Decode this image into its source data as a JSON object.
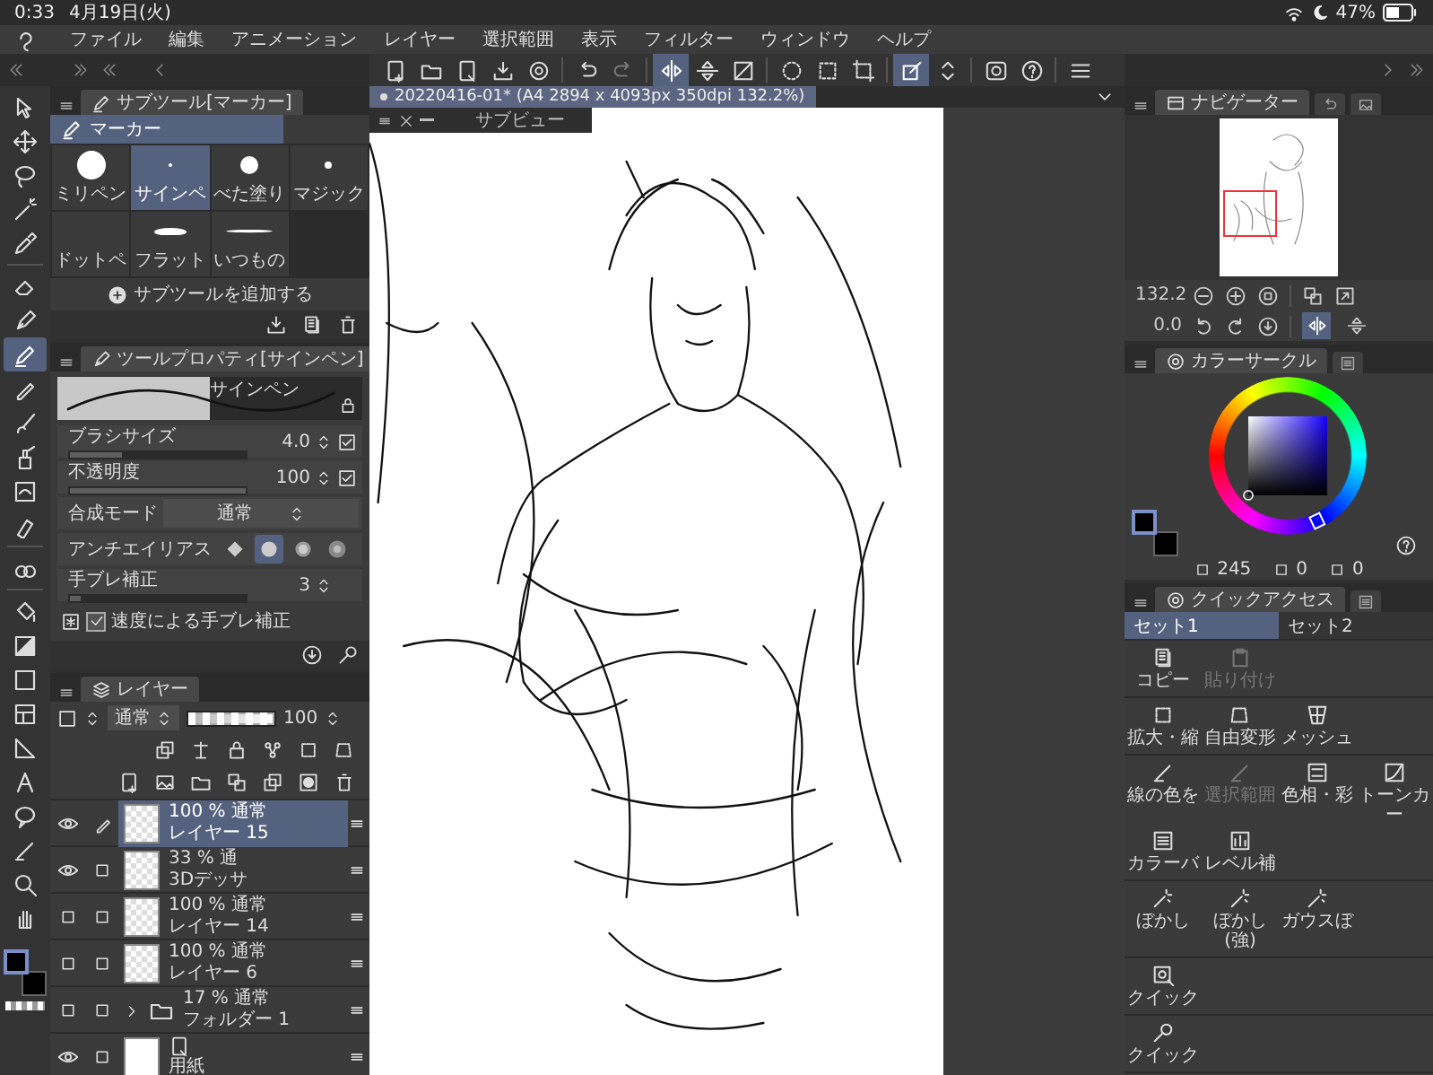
{
  "status_bar": {
    "time": "0:33",
    "date": "4月19日(火)",
    "battery": "47%"
  },
  "menu": [
    "ファイル",
    "編集",
    "アニメーション",
    "レイヤー",
    "選択範囲",
    "表示",
    "フィルター",
    "ウィンドウ",
    "ヘルプ"
  ],
  "toolbar": [
    [
      {
        "kind": "new-page",
        "selected": false,
        "disabled": false
      },
      {
        "kind": "open-folder",
        "selected": false,
        "disabled": false
      },
      {
        "kind": "page-refresh",
        "selected": false,
        "disabled": false
      },
      {
        "kind": "export",
        "selected": false,
        "disabled": false
      },
      {
        "kind": "cloud",
        "selected": false,
        "disabled": false
      }
    ],
    [
      {
        "kind": "undo",
        "selected": false,
        "disabled": false
      },
      {
        "kind": "redo",
        "selected": false,
        "disabled": true
      }
    ],
    [
      {
        "kind": "flip-horizontal",
        "selected": true,
        "disabled": false
      },
      {
        "kind": "flip-vertical",
        "selected": false,
        "disabled": false
      },
      {
        "kind": "transform",
        "selected": false,
        "disabled": false
      }
    ],
    [
      {
        "kind": "select-ellipse",
        "selected": false,
        "disabled": false
      },
      {
        "kind": "select-square",
        "selected": false,
        "disabled": false
      },
      {
        "kind": "crop",
        "selected": false,
        "disabled": false
      }
    ],
    [
      {
        "kind": "edit-square",
        "selected": true,
        "disabled": false
      },
      {
        "kind": "up-down",
        "selected": false,
        "disabled": false
      }
    ],
    [
      {
        "kind": "eye-target",
        "selected": false,
        "disabled": false
      },
      {
        "kind": "help",
        "selected": false,
        "disabled": false
      }
    ],
    [
      {
        "kind": "menu",
        "selected": false,
        "disabled": false
      }
    ]
  ],
  "tools": [
    [
      {
        "kind": "cursor",
        "selected": false
      },
      {
        "kind": "move",
        "selected": false
      },
      {
        "kind": "lasso",
        "selected": false
      },
      {
        "kind": "wand",
        "selected": false
      },
      {
        "kind": "dropper",
        "selected": false
      }
    ],
    [
      {
        "kind": "eraser",
        "selected": false
      },
      {
        "kind": "pen",
        "selected": false
      },
      {
        "kind": "marker",
        "selected": true
      },
      {
        "kind": "pencil",
        "selected": false
      },
      {
        "kind": "brush",
        "selected": false
      },
      {
        "kind": "airbrush",
        "selected": false
      },
      {
        "kind": "decoration",
        "selected": false
      },
      {
        "kind": "blend",
        "selected": false
      }
    ],
    [
      {
        "kind": "blob",
        "selected": false
      }
    ],
    [
      {
        "kind": "bucket",
        "selected": false
      },
      {
        "kind": "gradient",
        "selected": false
      },
      {
        "kind": "rect",
        "selected": false
      },
      {
        "kind": "frame",
        "selected": false
      },
      {
        "kind": "ruler",
        "selected": false
      },
      {
        "kind": "text",
        "selected": false
      },
      {
        "kind": "balloon",
        "selected": false
      },
      {
        "kind": "line",
        "selected": false
      },
      {
        "kind": "zoom",
        "selected": false
      },
      {
        "kind": "hand",
        "selected": false
      }
    ]
  ],
  "swatches": [
    {
      "color": "#000000"
    },
    {
      "color": "#000000"
    }
  ],
  "subtool": {
    "title": "サブツール[マーカー]",
    "group": {
      "label": "マーカー",
      "selected": true
    },
    "items": [
      {
        "kind": "dot-large",
        "label": "ミリペン",
        "selected": false
      },
      {
        "kind": "dot-tiny",
        "label": "サインペ",
        "selected": true
      },
      {
        "kind": "dot-medium",
        "label": "べた塗り",
        "selected": false
      },
      {
        "kind": "dot-small",
        "label": "マジック",
        "selected": false
      },
      {
        "kind": "blank",
        "label": "ドットペ",
        "selected": false
      },
      {
        "kind": "flat",
        "label": "フラット",
        "selected": false
      },
      {
        "kind": "line",
        "label": "いつもの",
        "selected": false
      }
    ],
    "add_label": "サブツールを追加する"
  },
  "tool_property": {
    "title": "ツールプロパティ[サインペン]",
    "preview_label": "サインペン",
    "rows": [
      {
        "kind": "slider",
        "label": "ブラシサイズ",
        "value": "4.0",
        "level": 0.3,
        "pressure": true
      },
      {
        "kind": "slider",
        "label": "不透明度",
        "value": "100",
        "level": 1,
        "pressure": true
      },
      {
        "kind": "select",
        "label": "合成モード",
        "value": "通常"
      },
      {
        "kind": "choice",
        "label": "アンチエイリアス",
        "options": [
          {
            "selected": false
          },
          {
            "selected": true
          },
          {
            "selected": false
          },
          {
            "selected": false
          }
        ]
      },
      {
        "kind": "slider",
        "label": "手ブレ補正",
        "value": "3",
        "level": 0.06,
        "pressure": false
      },
      {
        "kind": "check",
        "label": "速度による手ブレ補正",
        "checked": true
      }
    ]
  },
  "layers": {
    "title": "レイヤー",
    "blend_mode": "通常",
    "opacity": "100",
    "opacity_bar": {
      "level": 1
    },
    "items": [
      {
        "kind": "raster",
        "opacity": "100 %",
        "mode": "通常",
        "name": "レイヤー 15",
        "visible": true,
        "editing": true,
        "selected": true
      },
      {
        "kind": "model",
        "opacity": "33 %",
        "mode": "通",
        "name": "3Dデッサ",
        "visible": true,
        "editing": false,
        "selected": false
      },
      {
        "kind": "raster",
        "opacity": "100 %",
        "mode": "通常",
        "name": "レイヤー 14",
        "visible": false,
        "editing": false,
        "selected": false
      },
      {
        "kind": "raster",
        "opacity": "100 %",
        "mode": "通常",
        "name": "レイヤー 6",
        "visible": false,
        "editing": false,
        "selected": false
      },
      {
        "kind": "folder",
        "opacity": "17 %",
        "mode": "通常",
        "name": "フォルダー 1",
        "visible": false,
        "editing": false,
        "selected": false
      },
      {
        "kind": "paper",
        "name": "用紙",
        "visible": true,
        "editing": false,
        "selected": false
      }
    ]
  },
  "document": {
    "title": "20220416-01* (A4 2894 x 4093px 350dpi 132.2%)",
    "subview": "サブビュー"
  },
  "navigator": {
    "title": "ナビゲーター",
    "zoom": "132.2",
    "angle": "0.0",
    "flip_horizontal": true,
    "flip_vertical": false
  },
  "color_circle": {
    "title": "カラーサークル",
    "values": [
      "245",
      "0",
      "0"
    ]
  },
  "quick_access": {
    "title": "クイックアクセス",
    "tabs": [
      {
        "label": "セット1",
        "selected": true
      },
      {
        "label": "セット2",
        "selected": false
      }
    ],
    "groups": [
      [
        {
          "kind": "copy",
          "label": "コピー",
          "disabled": false
        },
        {
          "kind": "paste",
          "label": "貼り付け",
          "disabled": true
        }
      ],
      [
        {
          "kind": "scale",
          "label": "拡大・縮",
          "disabled": false
        },
        {
          "kind": "free-transform",
          "label": "自由変形",
          "disabled": false
        },
        {
          "kind": "mesh",
          "label": "メッシュ",
          "disabled": false
        }
      ],
      [
        {
          "kind": "line-color",
          "label": "線の色を",
          "disabled": false
        },
        {
          "kind": "line-color",
          "label": "選択範囲",
          "disabled": true
        },
        {
          "kind": "hue",
          "label": "色相・彩",
          "disabled": false
        },
        {
          "kind": "curve",
          "label": "トーンカー",
          "disabled": false
        },
        {
          "kind": "balance",
          "label": "カラーバ",
          "disabled": false
        },
        {
          "kind": "levels",
          "label": "レベル補",
          "disabled": false
        }
      ],
      [
        {
          "kind": "blur",
          "label": "ぼかし",
          "disabled": false
        },
        {
          "kind": "blur",
          "label": "ぼかし(強)",
          "disabled": false
        },
        {
          "kind": "blur",
          "label": "ガウスぼ",
          "disabled": false
        }
      ],
      [
        {
          "kind": "quick-square",
          "label": "クイック",
          "disabled": false
        }
      ],
      [
        {
          "kind": "wrench",
          "label": "クイック",
          "disabled": false
        }
      ]
    ]
  }
}
